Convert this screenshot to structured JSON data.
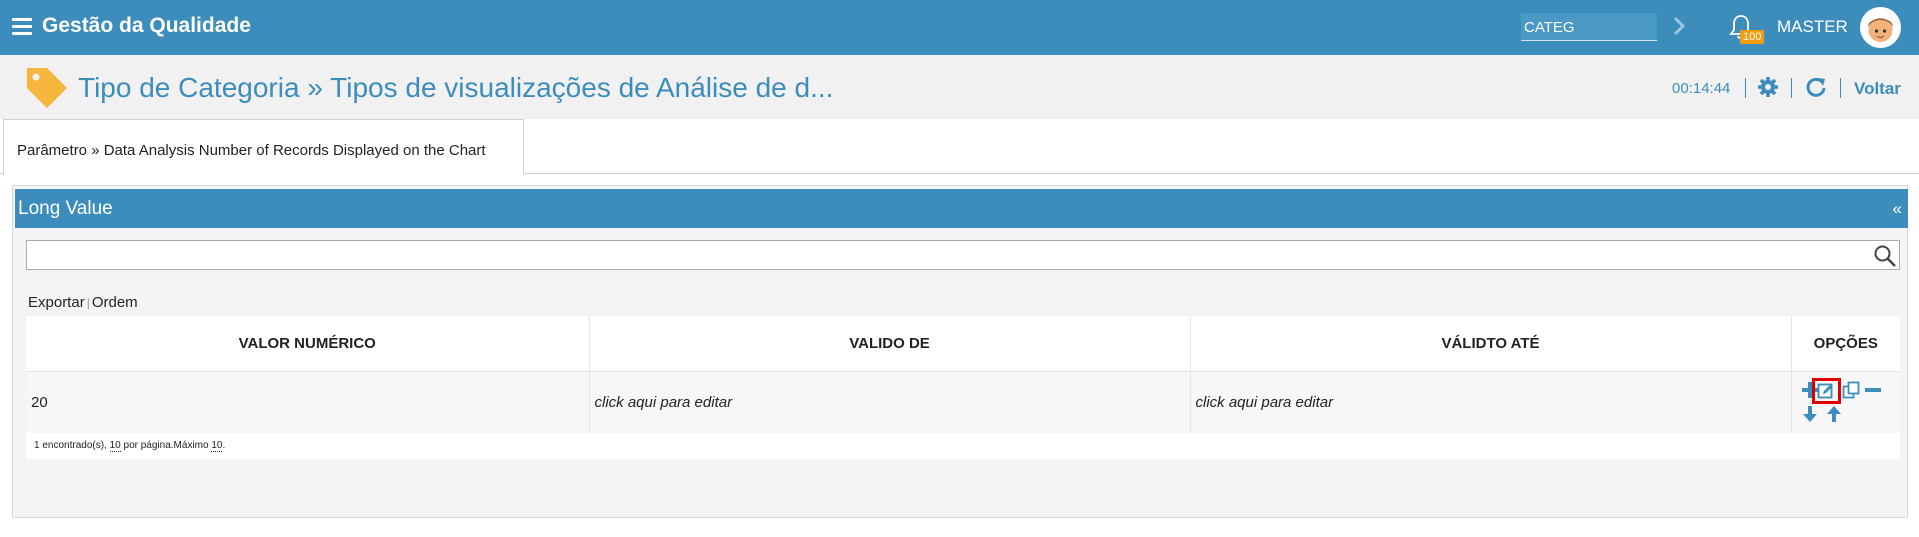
{
  "header": {
    "app_title": "Gestão da Qualidade",
    "search_value": "CATEG",
    "notification_count": "100",
    "user_name": "MASTER"
  },
  "page": {
    "title": "Tipo de Categoria » Tipos de visualizações de Análise de d...",
    "timer": "00:14:44",
    "back_label": "Voltar"
  },
  "tab": {
    "label": "Parâmetro  »  Data Analysis Number of Records Displayed on the Chart"
  },
  "panel": {
    "title": "Long Value",
    "collapse": "«"
  },
  "links": {
    "export": "Exportar",
    "order": "Ordem"
  },
  "table": {
    "columns": [
      "VALOR NUMÉRICO",
      "VALIDO DE",
      "VÁLIDTO ATÉ",
      "OPÇÕES"
    ],
    "rows": [
      {
        "value": "20",
        "valid_from": "click aqui para editar",
        "valid_to": "click aqui para editar"
      }
    ],
    "paging": {
      "found": "1 encontrado(s), ",
      "per_page_num": "10",
      "per_page_text": " por página.Máximo ",
      "max_num": "10",
      "end": "."
    }
  },
  "colors": {
    "primary": "#3c8dbc",
    "badge": "#f39c12",
    "highlight": "#e00000"
  },
  "icons": [
    "menu-icon",
    "chevron-right-icon",
    "bell-icon",
    "avatar",
    "tag-icon",
    "gear-icon",
    "refresh-icon",
    "search-icon",
    "plus-icon",
    "edit-icon",
    "copy-icon",
    "minus-icon",
    "arrow-down-icon",
    "arrow-up-icon"
  ]
}
